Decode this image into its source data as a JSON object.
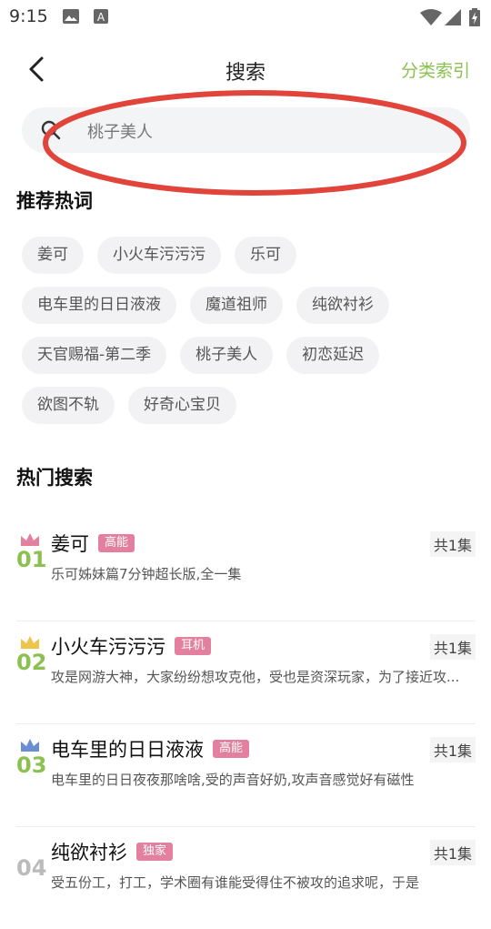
{
  "status_bar": {
    "time": "9:15",
    "icons": [
      "image-icon",
      "a-icon",
      "wifi-icon",
      "signal-icon",
      "battery-icon"
    ]
  },
  "header": {
    "title": "搜索",
    "right_link": "分类索引",
    "accent_color": "#8cc152"
  },
  "search": {
    "value": "桃子美人"
  },
  "hot_words": {
    "title": "推荐热词",
    "rows": [
      [
        "姜可",
        "小火车污污污",
        "乐可"
      ],
      [
        "电车里的日日液液",
        "魔道祖师",
        "纯欲衬衫"
      ],
      [
        "天官赐福-第二季",
        "桃子美人",
        "初恋延迟"
      ],
      [
        "欲图不轨",
        "好奇心宝贝"
      ]
    ]
  },
  "hot_search": {
    "title": "热门搜索",
    "items": [
      {
        "rank": "01",
        "title": "姜可",
        "badge": "高能",
        "episodes": "共1集",
        "desc": "乐可姊妹篇7分钟超长版,全一集",
        "crown_color": "#e3809f"
      },
      {
        "rank": "02",
        "title": "小火车污污污",
        "badge": "耳机",
        "episodes": "共1集",
        "desc": "攻是网游大神，大家纷纷想攻克他，受也是资深玩家，为了接近攻...",
        "crown_color": "#f0c44a"
      },
      {
        "rank": "03",
        "title": "电车里的日日液液",
        "badge": "高能",
        "episodes": "共1集",
        "desc": "电车里的日日夜夜那啥啥,受的声音好奶,攻声音感觉好有磁性",
        "crown_color": "#6a8fd0"
      },
      {
        "rank": "04",
        "title": "纯欲衬衫",
        "badge": "独家",
        "episodes": "共1集",
        "desc": "受五份工，打工，学术圈有谁能受得住不被攻的追求呢，于是",
        "crown_color": "#cccccc"
      }
    ]
  }
}
